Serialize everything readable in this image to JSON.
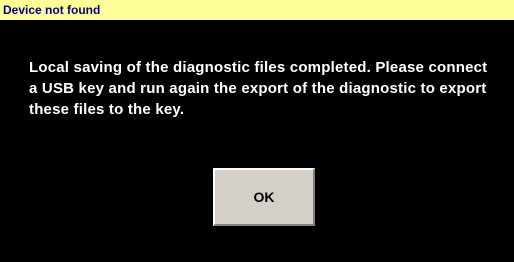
{
  "dialog": {
    "title": "Device not found",
    "message": "Local saving of the diagnostic files completed. Please connect a USB key and run again the export of the diagnostic to export these files to the key.",
    "ok_label": "OK"
  },
  "colors": {
    "title_bar_background": "#ffff99",
    "title_text": "#000080",
    "dialog_background": "#000000",
    "message_text": "#ffffff",
    "button_background": "#d4d0c8"
  }
}
